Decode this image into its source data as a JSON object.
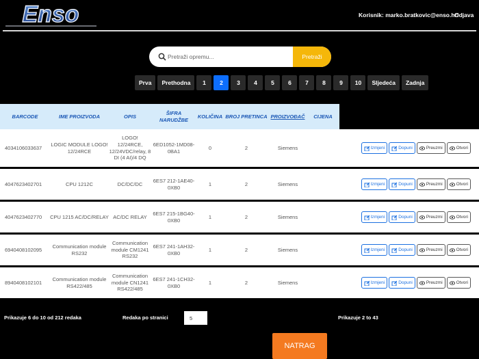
{
  "header": {
    "logo_text": "Enso",
    "user_label": "Korisnik: marko.bratkovic@enso.hr!",
    "logout_label": "Odjava"
  },
  "search": {
    "placeholder": "Pretraži opremu...",
    "button_label": "Pretraži"
  },
  "pagination": {
    "first": "Prva",
    "prev": "Prethodna",
    "pages": [
      "1",
      "2",
      "3",
      "4",
      "5",
      "6",
      "7",
      "8",
      "9",
      "10"
    ],
    "active_page": "2",
    "next": "Sljedeća",
    "last": "Zadnja"
  },
  "table": {
    "columns": [
      "BARCODE",
      "IME PROIZVODA",
      "OPIS",
      "ŠIFRA NARUDŽBE",
      "KOLIČINA",
      "BROJ PRETINCA",
      "PROIZVOĐAČ",
      "CIJENA"
    ],
    "rows": [
      {
        "barcode": "4034106033637",
        "ime": "LOGIC MODULE LOGO! 12/24RCE",
        "opis": "LOGO! 12/24RCE, 12/24VDC/relay, 8 DI (4 AI)/4 DQ",
        "sifra": "6ED1052-1MD08-0BA1",
        "kolicina": "0",
        "pretinac": "2",
        "proizvodac": "Siemens",
        "cijena": ""
      },
      {
        "barcode": "4047623402701",
        "ime": "CPU 1212C",
        "opis": "DC/DC/DC",
        "sifra": "6ES7 212-1AE40-0XB0",
        "kolicina": "1",
        "pretinac": "2",
        "proizvodac": "Siemens",
        "cijena": ""
      },
      {
        "barcode": "4047623402770",
        "ime": "CPU 1215 AC/DC/RELAY",
        "opis": "AC/DC RELAY",
        "sifra": "6ES7 215-1BG40-0XB0",
        "kolicina": "1",
        "pretinac": "2",
        "proizvodac": "Siemens",
        "cijena": ""
      },
      {
        "barcode": "6940408102095",
        "ime": "Communication module RS232",
        "opis": "Communication module CM1241 RS232",
        "sifra": "6ES7 241-1AH32-0XB0",
        "kolicina": "1",
        "pretinac": "2",
        "proizvodac": "Siemens",
        "cijena": ""
      },
      {
        "barcode": "8940408102101",
        "ime": "Communication module RS422/485",
        "opis": "Communication module CN1241 RS422/485",
        "sifra": "6ES7 241-1CH32-0XB0",
        "kolicina": "1",
        "pretinac": "2",
        "proizvodac": "Siemens",
        "cijena": ""
      }
    ],
    "actions": {
      "edit": "Izmjeni",
      "supplement": "Dopuni",
      "download": "Preuzmi",
      "open": "Otvori"
    }
  },
  "footer": {
    "showing": "Prikazuje 6 do 10 od 212 redaka",
    "rows_per_page_label": "Redaka po stranici",
    "rows_per_page_value": "5",
    "page_range": "Prikazuje 2 to 43",
    "back_label": "NATRAG"
  },
  "colors": {
    "accent_blue": "#0d6efd",
    "search_button": "#f5b70a",
    "back_button": "#f47a20",
    "header_row": "#d6ebfa"
  }
}
